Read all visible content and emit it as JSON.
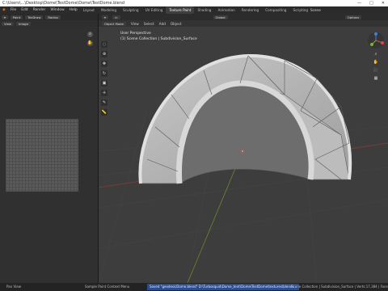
{
  "window": {
    "title": "C:\\Users\\...\\Desktop\\Dome\\TestDome\\Dome\\TestDome.blend",
    "controls": [
      "—",
      "□",
      "✕"
    ]
  },
  "menu": [
    "File",
    "Edit",
    "Render",
    "Window",
    "Help"
  ],
  "workspaces": [
    "Layout",
    "Modeling",
    "Sculpting",
    "UV Editing",
    "Texture Paint",
    "Shading",
    "Animation",
    "Rendering",
    "Compositing",
    "Scripting"
  ],
  "active_workspace": "Texture Paint",
  "scene_label": "Scene",
  "left_panel": {
    "mode_chip": "Paint",
    "brush_chip": "TexDraw",
    "radius_chip": "Radius",
    "view_chip": "View",
    "image_chip": "Image"
  },
  "viewport": {
    "mode": "Object Mode",
    "menus": [
      "View",
      "Select",
      "Add",
      "Object"
    ],
    "global_label": "Global",
    "options_label": "Options",
    "info_line1": "User Perspective",
    "info_line2": "(1) Scene Collection | Subdivision_Surface"
  },
  "statusbar": {
    "left": "Pan View",
    "middle": "Sample Paint Context Menu",
    "message": "Saved \"geodesicDome.blend\"  D:\\Turbosquid\\Dome_tent\\Dome\\TestDome\\textures\\blends...",
    "right": "Scene Collection | Subdivision_Surface | Verts:17,384 | Faces:10"
  },
  "colors": {
    "accent": "#2b4c8f",
    "viewport_bg": "#3d3d3d"
  }
}
